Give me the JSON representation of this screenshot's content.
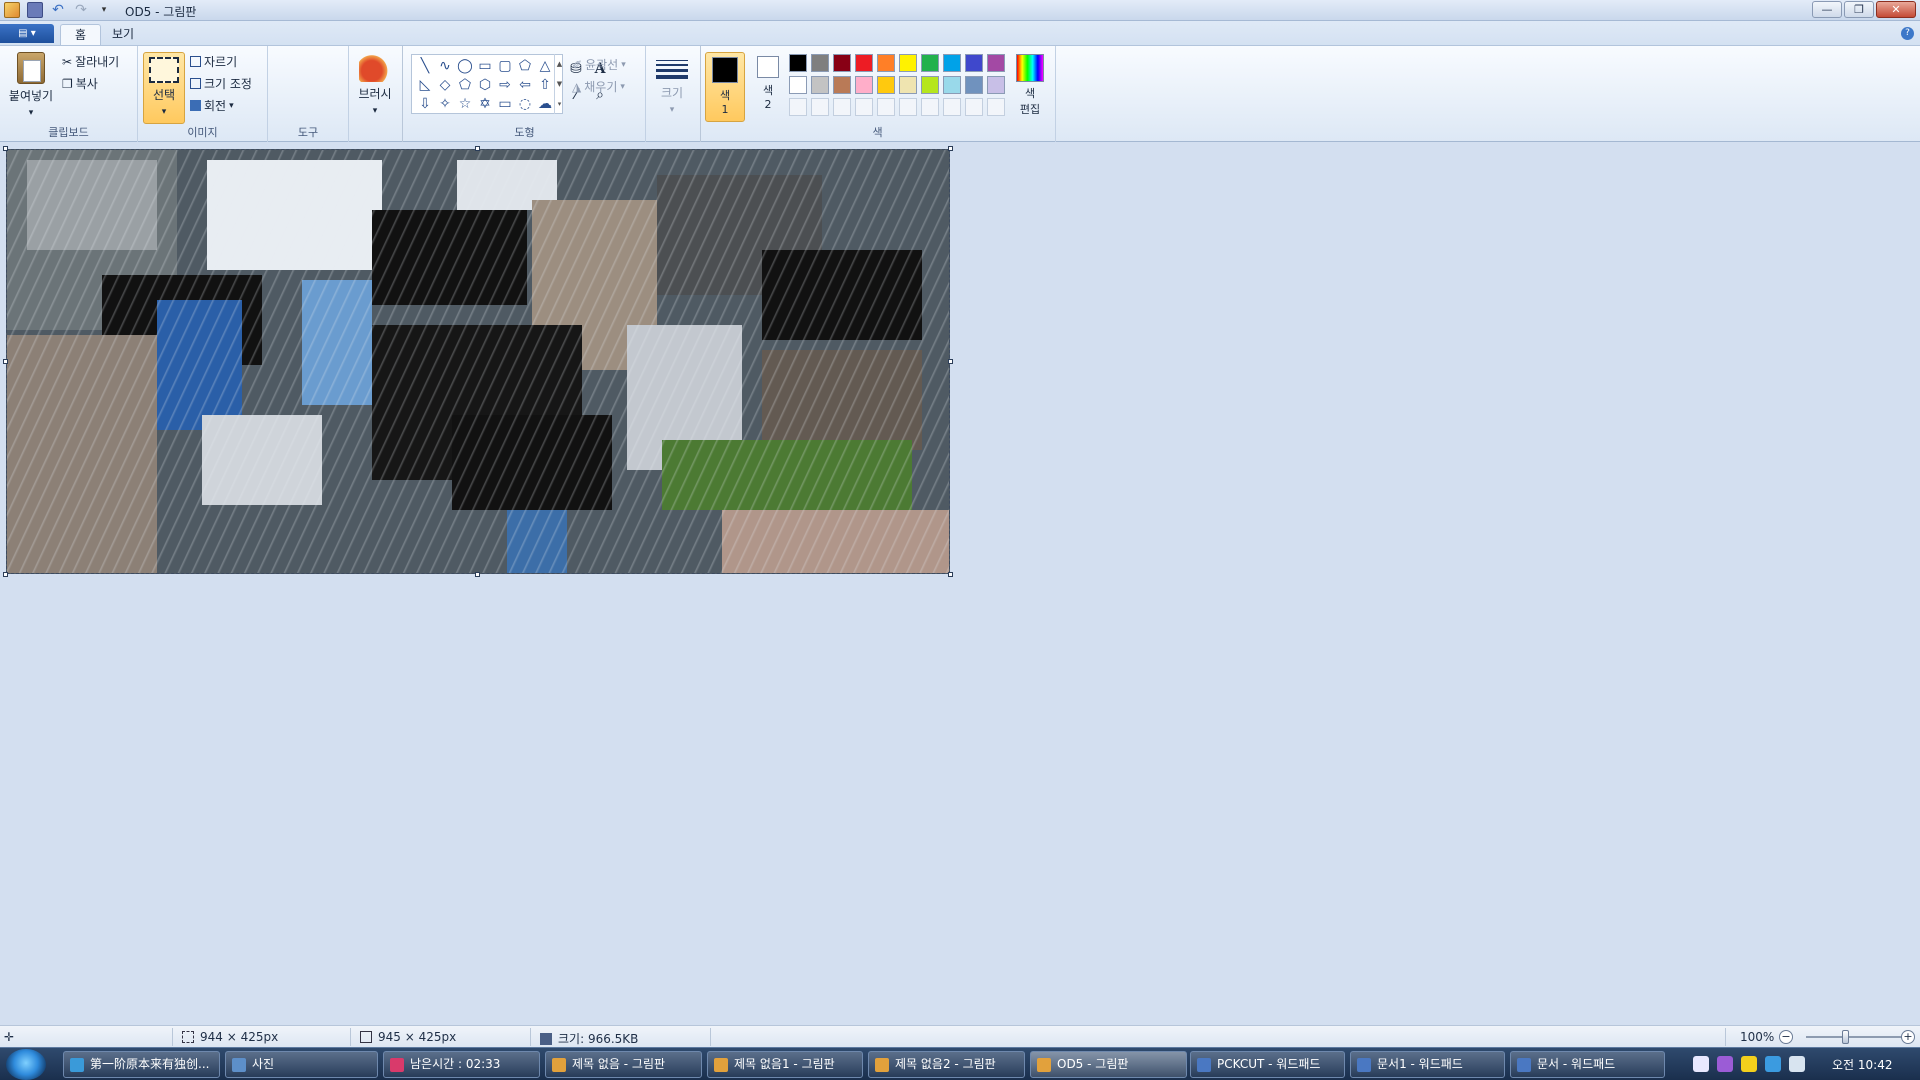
{
  "window": {
    "title": "OD5 - 그림판",
    "minimize": "—",
    "restore": "❐",
    "close": "✕"
  },
  "quick_access": {
    "undo": "↶",
    "redo": "↷",
    "dropdown": "▾"
  },
  "menu": {
    "app_button": "▤ ▾",
    "help": "?"
  },
  "tabs": [
    {
      "label": "홈",
      "active": true
    },
    {
      "label": "보기",
      "active": false
    }
  ],
  "ribbon": {
    "clipboard": {
      "label": "클립보드",
      "paste": "붙여넣기",
      "cut": "잘라내기",
      "copy": "복사",
      "cut_icon": "✂",
      "copy_icon": "❐"
    },
    "image": {
      "label": "이미지",
      "select": "선택",
      "crop": "자르기",
      "resize": "크기 조정",
      "rotate": "회전",
      "dropdown": "▾"
    },
    "tools": {
      "label": "도구",
      "icons": [
        "✎",
        "⛁",
        "A",
        "▰",
        "⁄",
        "⌕"
      ]
    },
    "brushes": {
      "label": "브러시",
      "dropdown": "▾"
    },
    "shapes": {
      "label": "도형",
      "outline": "윤곽선",
      "fill": "채우기",
      "outline_icon": "✐",
      "fill_icon": "◮",
      "glyphs": [
        "╲",
        "∿",
        "◯",
        "▭",
        "▢",
        "⬠",
        "△",
        "◺",
        "◇",
        "⬠",
        "⬡",
        "⇨",
        "⇦",
        "⇧",
        "⇩",
        "✧",
        "☆",
        "✡",
        "▭",
        "◌",
        "☁"
      ],
      "scroll": [
        "▲",
        "▼",
        "▾"
      ]
    },
    "size": {
      "label": "크기",
      "dropdown": "▾"
    },
    "colors": {
      "label": "색",
      "color1": "색\n1",
      "color2": "색\n2",
      "edit": "색\n편집",
      "color1_value": "#000000",
      "color2_value": "#ffffff",
      "palette": [
        "#000000",
        "#7f7f7f",
        "#880015",
        "#ed1c24",
        "#ff7f27",
        "#fff200",
        "#22b14c",
        "#00a2e8",
        "#3f48cc",
        "#a349a4",
        "#ffffff",
        "#c3c3c3",
        "#b97a57",
        "#ffaec9",
        "#ffc90e",
        "#efe4b0",
        "#b5e61d",
        "#99d9ea",
        "#7092be",
        "#c8bfe7",
        "",
        "",
        "",
        "",
        "",
        "",
        "",
        "",
        "",
        ""
      ]
    }
  },
  "status": {
    "cursor_icon": "✛",
    "image_size": "944 × 425px",
    "selection_size": "945 × 425px",
    "file_size": "크기: 966.5KB",
    "zoom": "100%",
    "zoom_out": "−",
    "zoom_in": "+"
  },
  "taskbar": {
    "items": [
      {
        "label": "第一阶原本来有独创...",
        "color": "#3a9ad9"
      },
      {
        "label": "사진",
        "color": "#5d8fc9"
      },
      {
        "label": "남은시간 : 02:33",
        "color": "#d93a6b"
      },
      {
        "label": "제목 없음 - 그림판",
        "color": "#e2a13c"
      },
      {
        "label": "제목 없음1 - 그림판",
        "color": "#e2a13c"
      },
      {
        "label": "제목 없음2 - 그림판",
        "color": "#e2a13c"
      },
      {
        "label": "OD5 - 그림판",
        "color": "#e2a13c",
        "active": true
      },
      {
        "label": "PCKCUT - 워드패드",
        "color": "#4a78c2"
      },
      {
        "label": "문서1 - 워드패드",
        "color": "#4a78c2"
      },
      {
        "label": "문서 - 워드패드",
        "color": "#4a78c2"
      }
    ],
    "tray_colors": [
      "#e8e8ff",
      "#9b5cd6",
      "#f3d01c",
      "#3b9be0",
      "#d8e4f0"
    ],
    "clock": "오전 10:42"
  }
}
